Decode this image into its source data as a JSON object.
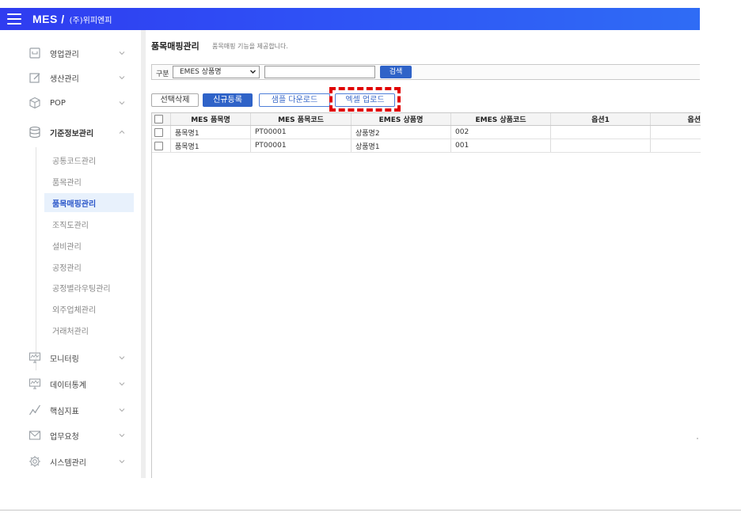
{
  "header": {
    "brand": "MES /",
    "brand_sub": "(주)위피엔피"
  },
  "sidebar": {
    "items": [
      {
        "label": "영업관리",
        "icon": "square-icon"
      },
      {
        "label": "생산관리",
        "icon": "edit-icon"
      },
      {
        "label": "POP",
        "icon": "cube-icon"
      },
      {
        "label": "기준정보관리",
        "icon": "database-icon"
      },
      {
        "label": "모니터링",
        "icon": "monitor-icon"
      },
      {
        "label": "데이터통계",
        "icon": "monitor-chart-icon"
      },
      {
        "label": "핵심지표",
        "icon": "trend-line-icon"
      },
      {
        "label": "업무요청",
        "icon": "mail-icon"
      },
      {
        "label": "시스템관리",
        "icon": "gear-icon"
      }
    ],
    "sub_items": [
      {
        "label": "공통코드관리",
        "active": false
      },
      {
        "label": "품목관리",
        "active": false
      },
      {
        "label": "품목매핑관리",
        "active": true
      },
      {
        "label": "조직도관리",
        "active": false
      },
      {
        "label": "설비관리",
        "active": false
      },
      {
        "label": "공정관리",
        "active": false
      },
      {
        "label": "공정별라우팅관리",
        "active": false
      },
      {
        "label": "외주업체관리",
        "active": false
      },
      {
        "label": "거래처관리",
        "active": false
      }
    ]
  },
  "main": {
    "title": "품목매핑관리",
    "description": "품목매핑 기능을 제공합니다.",
    "search": {
      "label": "구분",
      "selected": "EMES 상품명",
      "input_value": "",
      "button": "검색"
    },
    "buttons": {
      "delete": "선택삭제",
      "new": "신규등록",
      "sample_download": "샘플 다운로드",
      "excel_upload": "엑셀 업로드"
    },
    "table": {
      "columns": [
        "MES 품목명",
        "MES 품목코드",
        "EMES 상품명",
        "EMES 상품코드",
        "옵션1",
        "옵션"
      ],
      "rows": [
        [
          "품목명1",
          "PT00001",
          "상품명2",
          "002",
          "",
          ""
        ],
        [
          "품목명1",
          "PT00001",
          "상품명1",
          "001",
          "",
          ""
        ]
      ]
    }
  },
  "colors": {
    "header_bg": "#2f4ff5",
    "primary_button": "#2f63c8",
    "active_menu_bg": "#e8f1fc",
    "highlight": "#e00000"
  }
}
